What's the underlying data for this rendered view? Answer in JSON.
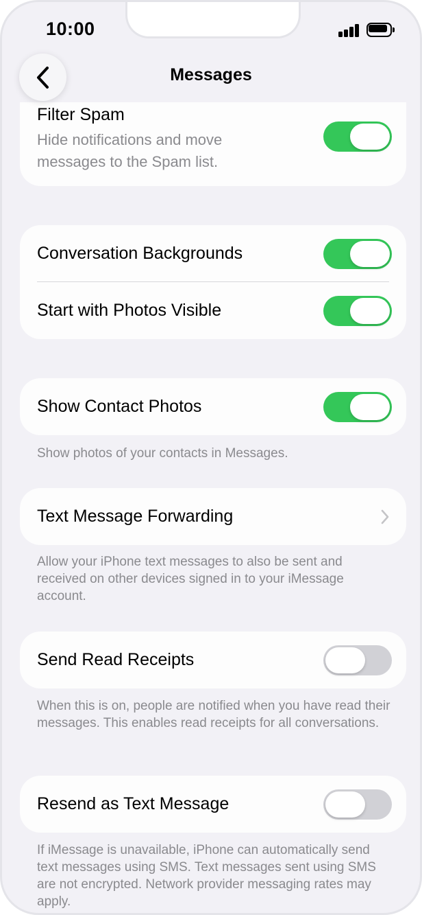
{
  "status_bar": {
    "time": "10:00"
  },
  "nav": {
    "title": "Messages"
  },
  "filter_spam": {
    "label": "Filter Spam",
    "description": "Hide notifications and move messages to the Spam list.",
    "on": true
  },
  "display_group": {
    "items": [
      {
        "label": "Conversation Backgrounds",
        "on": true
      },
      {
        "label": "Start with Photos Visible",
        "on": true
      }
    ]
  },
  "contact_photos": {
    "label": "Show Contact Photos",
    "on": true,
    "footnote": "Show photos of your contacts in Messages."
  },
  "text_forwarding": {
    "label": "Text Message Forwarding",
    "footnote": "Allow your iPhone text messages to also be sent and received on other devices signed in to your iMessage account."
  },
  "read_receipts": {
    "label": "Send Read Receipts",
    "on": false,
    "footnote": "When this is on, people are notified when you have read their messages. This enables read receipts for all conversations."
  },
  "resend_sms": {
    "label": "Resend as Text Message",
    "on": false,
    "footnote": "If iMessage is unavailable, iPhone can automatically send text messages using SMS. Text messages sent using SMS are not encrypted. Network provider messaging rates may apply."
  },
  "colors": {
    "toggle_on": "#34c759",
    "toggle_off": "#d1d1d6",
    "background": "#f2f1f6",
    "secondary_text": "#8a8a8e"
  }
}
